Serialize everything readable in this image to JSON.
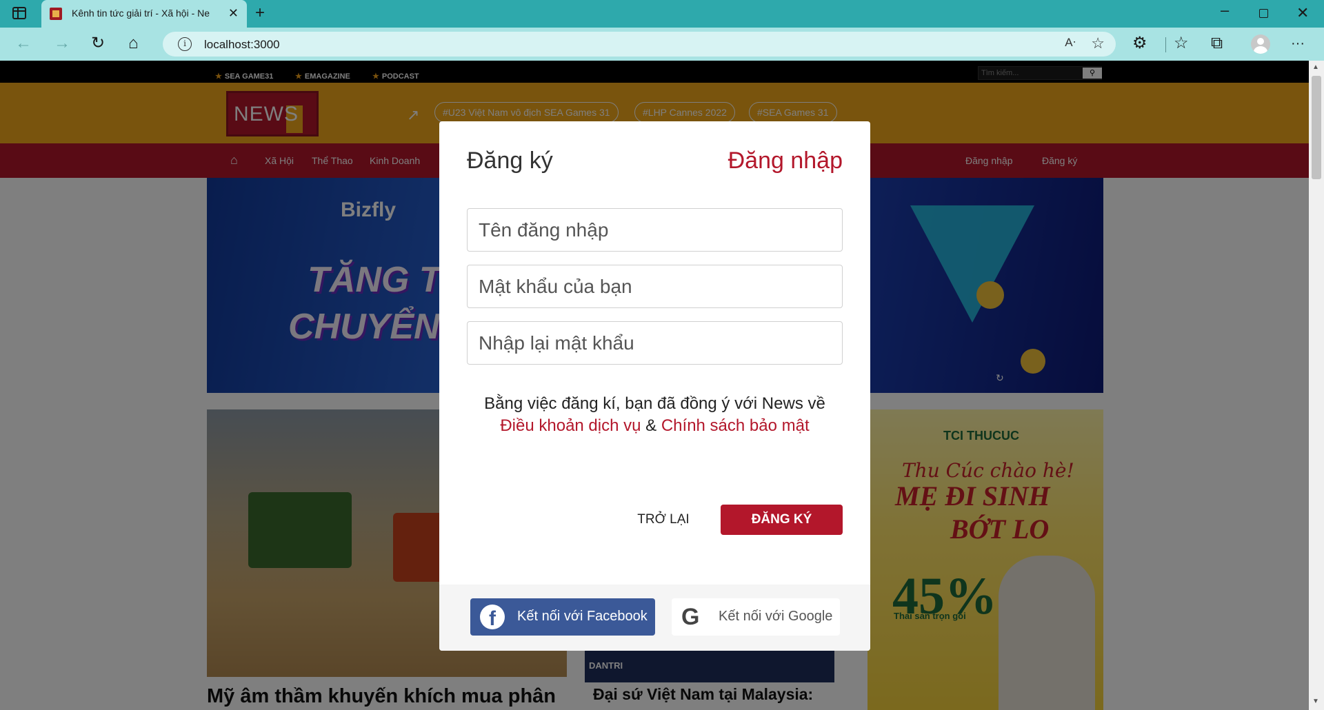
{
  "browser": {
    "tab_title": "Kênh tin tức giải trí - Xã hội - Ne",
    "url": "localhost:3000"
  },
  "site": {
    "topbar_items": [
      "SEA GAME31",
      "EMAGAZINE",
      "PODCAST"
    ],
    "search_placeholder": "Tìm kiếm...",
    "logo": "NEWS",
    "hashtags": [
      "#U23 Việt Nam vô địch SEA Games 31",
      "#LHP Cannes 2022",
      "#SEA Games 31"
    ],
    "nav": [
      "Xã Hội",
      "Thể Thao",
      "Kinh Doanh"
    ],
    "nav_login": "Đăng nhập",
    "nav_register": "Đăng ký",
    "banner": {
      "brand": "Bizfly",
      "line1": "TĂNG TI",
      "line2": "CHUYỂN"
    },
    "article_title": "Mỹ âm thầm khuyến khích mua phân",
    "article2_tag": "DANTRI",
    "article2_title": "Đại sứ Việt Nam tại Malaysia:",
    "ad": {
      "brand": "TCI THUCUC",
      "script": "Thu Cúc chào hè!",
      "line1": "MẸ ĐI SINH",
      "line2": "BỚT LO",
      "percent": "45%",
      "sub": "Thai sản trọn gói"
    }
  },
  "modal": {
    "title": "Đăng ký",
    "switch_link": "Đăng nhập",
    "fields": {
      "username_placeholder": "Tên đăng nhập",
      "password_placeholder": "Mật khẩu của bạn",
      "confirm_placeholder": "Nhập lại mật khẩu"
    },
    "terms_text": "Bằng việc đăng kí, bạn đã đồng ý với News về",
    "terms_link": "Điều khoản dịch vụ",
    "terms_amp": "&",
    "privacy_link": "Chính sách bảo mật",
    "back_button": "TRỞ LẠI",
    "register_button": "ĐĂNG KÝ",
    "facebook_button": "Kết nối với Facebook",
    "google_button": "Kết nối với Google"
  },
  "colors": {
    "brand_red": "#b3172b",
    "brand_orange": "#f2a81b",
    "facebook_blue": "#3b5998",
    "chrome_teal": "#2ea9ac"
  }
}
